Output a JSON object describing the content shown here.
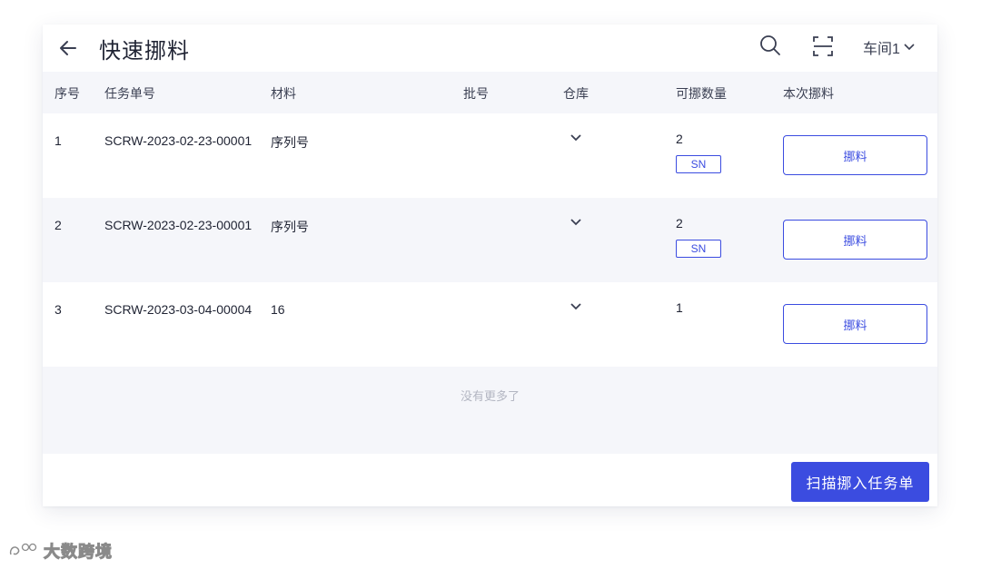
{
  "header": {
    "title": "快速挪料",
    "workshop": "车间1"
  },
  "table": {
    "columns": [
      "序号",
      "任务单号",
      "材料",
      "批号",
      "仓库",
      "可挪数量",
      "本次挪料"
    ],
    "rows": [
      {
        "index": "1",
        "task_no": "SCRW-2023-02-23-00001",
        "material": "序列号",
        "batch": "",
        "qty": "2",
        "tag": "SN",
        "action": "挪料"
      },
      {
        "index": "2",
        "task_no": "SCRW-2023-02-23-00001",
        "material": "序列号",
        "batch": "",
        "qty": "2",
        "tag": "SN",
        "action": "挪料"
      },
      {
        "index": "3",
        "task_no": "SCRW-2023-03-04-00004",
        "material": "16",
        "batch": "",
        "qty": "1",
        "action": "挪料"
      }
    ]
  },
  "no_more": "没有更多了",
  "footer": {
    "primary_button": "扫描挪入任务单"
  },
  "watermark": "大数跨境",
  "colors": {
    "accent": "#3b4ce0",
    "header_bg": "#f5f6fa",
    "muted": "#b3b6c2"
  }
}
